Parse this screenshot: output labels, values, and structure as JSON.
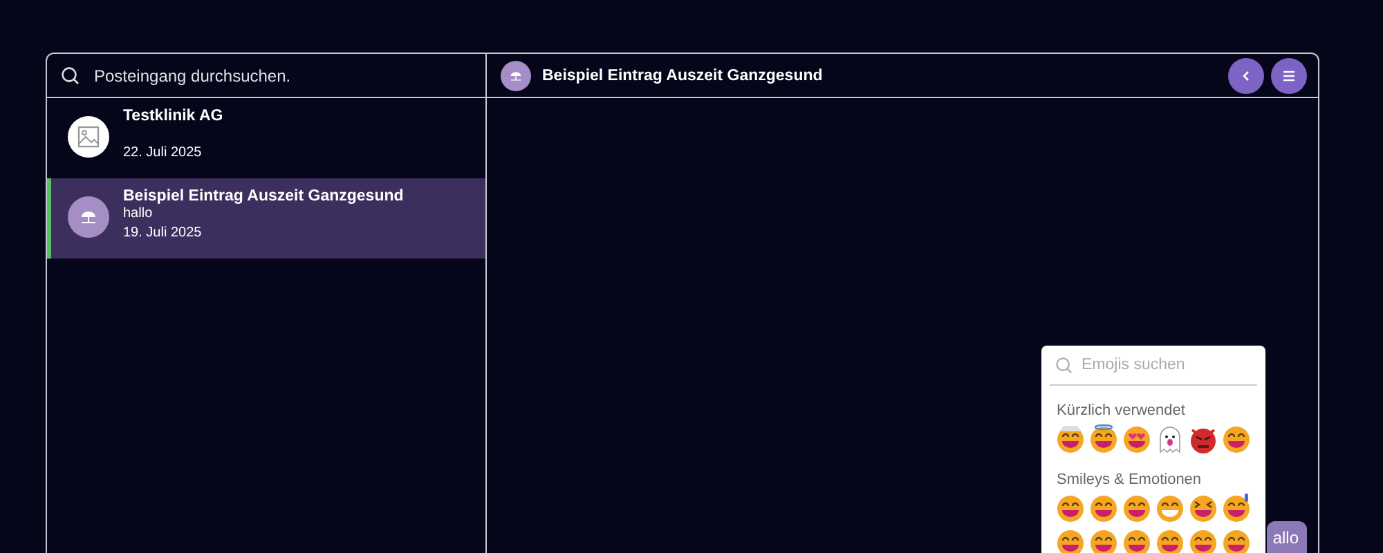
{
  "search": {
    "placeholder": "Posteingang durchsuchen."
  },
  "conversations": [
    {
      "title": "Testklinik AG",
      "date": "22. Juli 2025",
      "kind": "image",
      "selected": false
    },
    {
      "title": "Beispiel Eintrag Auszeit Ganzgesund",
      "preview": "hallo",
      "date": "19. Juli 2025",
      "kind": "umbrella",
      "selected": true
    }
  ],
  "chat": {
    "title": "Beispiel Eintrag Auszeit Ganzgesund",
    "message": "allo"
  },
  "emoji_picker": {
    "placeholder": "Emojis suchen",
    "sections": [
      {
        "title": "Kürzlich verwendet"
      },
      {
        "title": "Smileys & Emotionen"
      }
    ]
  }
}
